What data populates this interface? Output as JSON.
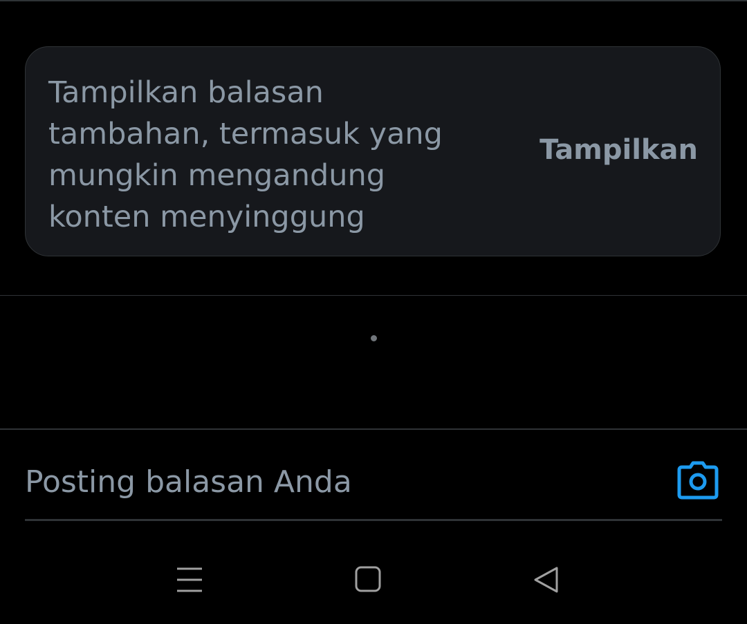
{
  "notice": {
    "message": "Tampilkan balasan tambahan, termasuk yang mungkin mengandung konten menyinggung",
    "button_label": "Tampilkan"
  },
  "reply": {
    "placeholder": "Posting balasan Anda",
    "camera_icon": "camera-icon"
  },
  "nav": {
    "icons": [
      "menu-icon",
      "home-icon",
      "back-icon"
    ]
  },
  "colors": {
    "background": "#000000",
    "card": "#16181c",
    "text_muted": "#8b98a5",
    "divider": "#2f3336",
    "accent": "#1d9bf0"
  }
}
